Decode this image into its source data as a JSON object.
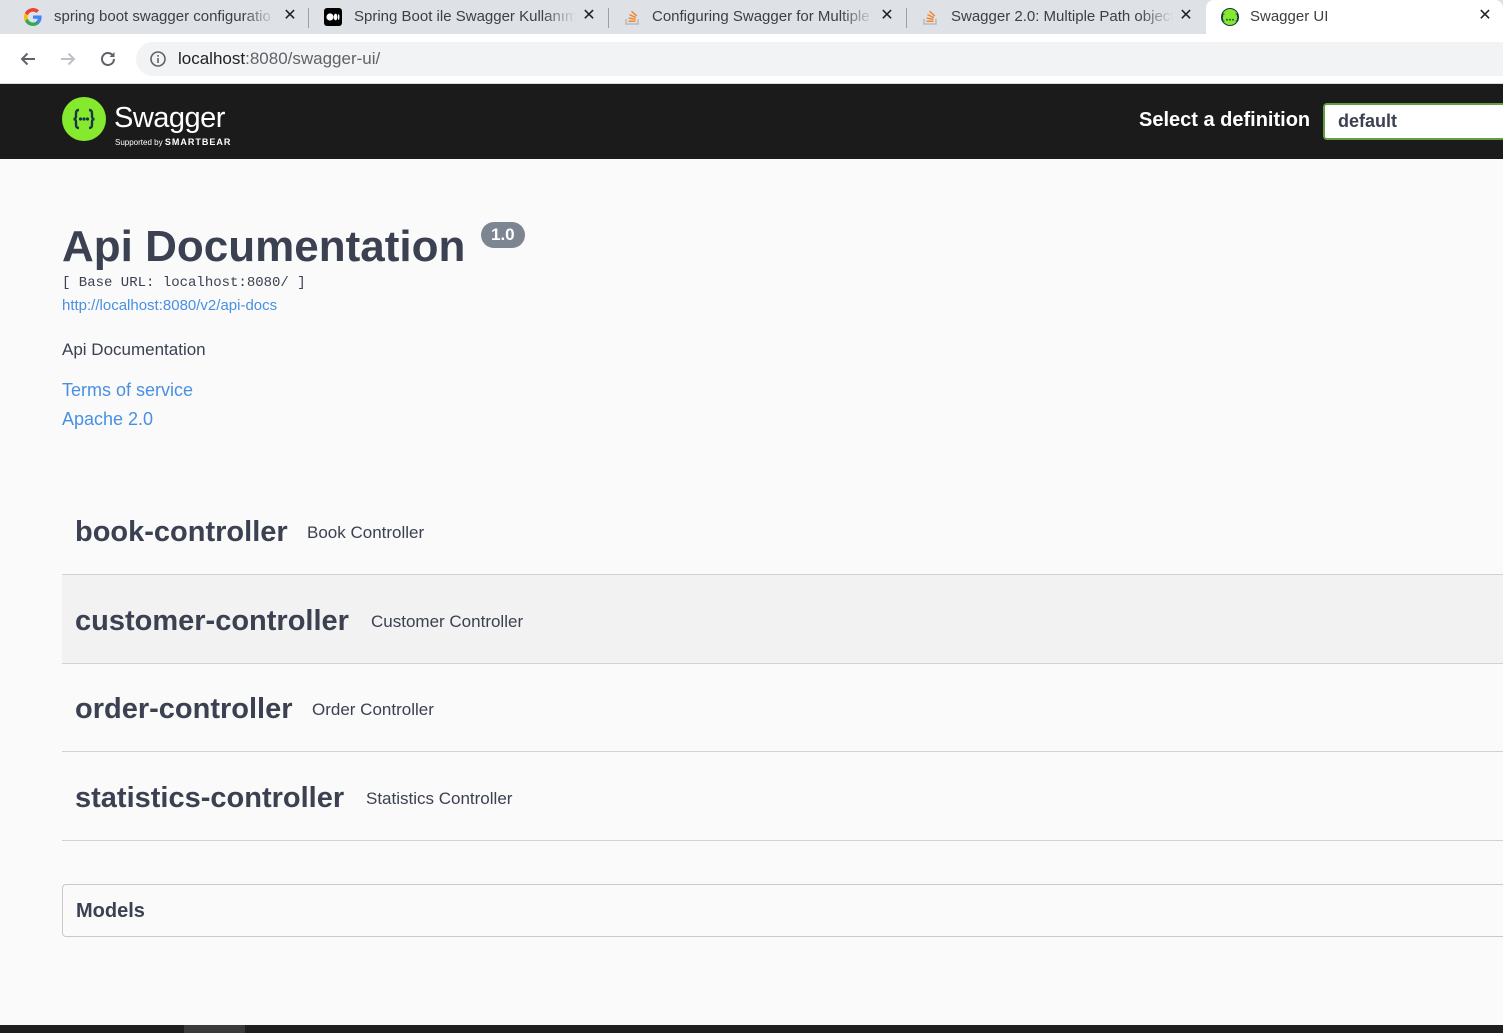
{
  "browser": {
    "tabs": [
      {
        "title": "spring boot swagger configuratio",
        "favicon": "google-icon"
      },
      {
        "title": "Spring Boot ile Swagger Kullanım",
        "favicon": "medium-icon"
      },
      {
        "title": "Configuring Swagger for Multiple",
        "favicon": "stackoverflow-icon"
      },
      {
        "title": "Swagger 2.0: Multiple Path object",
        "favicon": "stackoverflow-icon"
      },
      {
        "title": "Swagger UI",
        "favicon": "swagger-icon",
        "active": true
      }
    ],
    "close_glyph": "✕",
    "url_host": "localhost",
    "url_path": ":8080/swagger-ui/"
  },
  "topbar": {
    "logo_text": "Swagger",
    "logo_sub_prefix": "Supported by",
    "logo_sub_brand": "SMARTBEAR",
    "select_label": "Select a definition",
    "selected_definition": "default",
    "colors": {
      "bar": "#1b1b1b",
      "logo": "#85ea2d",
      "select_border": "#62a03f"
    }
  },
  "info": {
    "title": "Api Documentation",
    "version": "1.0",
    "base_url": "[ Base URL: localhost:8080/ ]",
    "api_docs_link": "http://localhost:8080/v2/api-docs",
    "description": "Api Documentation",
    "terms_link": "Terms of service",
    "license_link": "Apache 2.0"
  },
  "controllers": [
    {
      "name": "book-controller",
      "description": "Book Controller"
    },
    {
      "name": "customer-controller",
      "description": "Customer Controller"
    },
    {
      "name": "order-controller",
      "description": "Order Controller"
    },
    {
      "name": "statistics-controller",
      "description": "Statistics Controller"
    }
  ],
  "models": {
    "title": "Models"
  }
}
